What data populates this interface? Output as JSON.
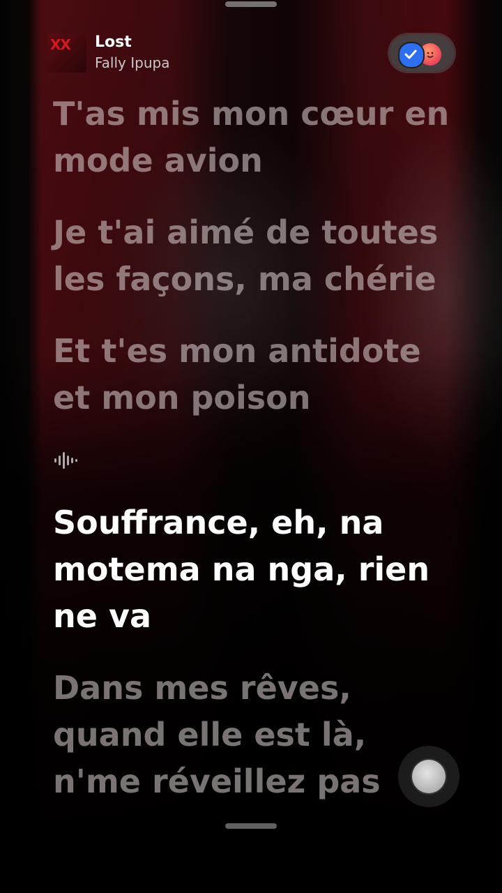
{
  "song": {
    "title": "Lost",
    "artist": "Fally Ipupa",
    "cover_text": "XX"
  },
  "share": {
    "icons": [
      "check-icon",
      "emoji-face-icon"
    ],
    "accent_colors": [
      "#2d6ff0",
      "#e8445a"
    ]
  },
  "lyrics": {
    "line1": {
      "row1": "T'as mis mon cœur en",
      "row2": "mode avion"
    },
    "line2": {
      "row1": "Je t'ai aimé de toutes",
      "row2": "les façons, ma chérie"
    },
    "line3": {
      "row1": "Et t'es mon antidote",
      "row2": "et mon poison"
    },
    "interlude_icon": "audio-wave-icon",
    "active": {
      "row1": "Souffrance, eh, na",
      "row2": "motema na nga, rien",
      "row3": "ne va"
    },
    "line5": {
      "row1": "Dans mes rêves,",
      "row2": "quand elle est là,",
      "row3": "n'me réveillez pas"
    }
  },
  "colors": {
    "active_lyric": "#ffffff",
    "inactive_lyric": "rgba(220,210,210,0.55)",
    "background_accent": "#4a0b10"
  }
}
